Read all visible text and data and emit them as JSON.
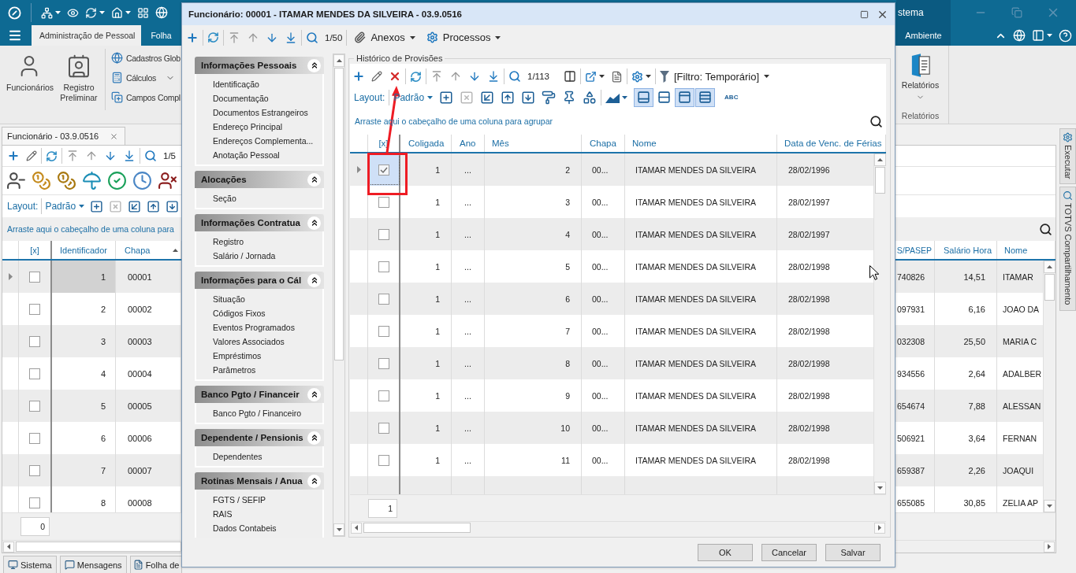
{
  "app": {
    "title": "stema",
    "tabs": [
      {
        "label": "Administração de Pessoal",
        "selected": true
      },
      {
        "label": "Folha",
        "selected": false
      }
    ],
    "context_tab": {
      "label": "Ambiente",
      "selected": false
    },
    "ribbon": {
      "large_buttons": [
        "Funcionários",
        "Registro Preliminar"
      ],
      "small_buttons": [
        {
          "label": "Cadastros Glob",
          "dropdown": false
        },
        {
          "label": "Cálculos",
          "dropdown": true
        },
        {
          "label": "Campos Compl",
          "dropdown": false
        }
      ],
      "reports": {
        "label": "Relatórios",
        "dropdown": true,
        "group": "Relatórios"
      }
    },
    "document_tab": "Funcionário - 03.9.0516",
    "panel": {
      "nav": [
        {
          "disabled": true
        },
        {
          "disabled": true
        },
        {
          "disabled": false
        },
        {
          "disabled": false
        }
      ],
      "counter": "1/5",
      "layout_label": "Layout:",
      "layout": "Padrão",
      "layout_tools": [
        {
          "disabled": false
        },
        {
          "disabled": true
        },
        {
          "disabled": false
        },
        {
          "disabled": false
        },
        {
          "disabled": false
        }
      ],
      "group_hint": "Arraste aqui o cabeçalho de uma coluna para",
      "table": {
        "check_column": "[x]",
        "columns": [
          {
            "label": "Identificador",
            "sorted": false
          },
          {
            "label": "Chapa",
            "sorted": true
          },
          {
            "label": "S/PASEP",
            "sorted": false
          },
          {
            "label": "Salário Hora",
            "sorted": false
          },
          {
            "label": "Nome",
            "sorted": false
          }
        ],
        "rows": [
          {
            "selected": true,
            "checked": false,
            "cells": [
              "1",
              "00001",
              "740826",
              "14,51",
              "ITAMAR"
            ]
          },
          {
            "selected": false,
            "checked": false,
            "cells": [
              "2",
              "00002",
              "097931",
              "6,16",
              "JOAO DA"
            ]
          },
          {
            "selected": false,
            "checked": false,
            "cells": [
              "3",
              "00003",
              "032308",
              "25,50",
              "MARIA C"
            ]
          },
          {
            "selected": false,
            "checked": false,
            "cells": [
              "4",
              "00004",
              "934556",
              "2,64",
              "ADALBER"
            ]
          },
          {
            "selected": false,
            "checked": false,
            "cells": [
              "5",
              "00005",
              "654674",
              "7,88",
              "ALESSAN"
            ]
          },
          {
            "selected": false,
            "checked": false,
            "cells": [
              "6",
              "00006",
              "506921",
              "3,64",
              "FERNAN"
            ]
          },
          {
            "selected": false,
            "checked": false,
            "cells": [
              "7",
              "00007",
              "659387",
              "2,26",
              "JOAQUI"
            ]
          },
          {
            "selected": false,
            "checked": false,
            "cells": [
              "8",
              "00008",
              "655085",
              "30,85",
              "ZELIA AP"
            ]
          }
        ]
      },
      "record_count": "0"
    },
    "status_tabs": [
      "Sistema",
      "Mensagens",
      "Folha de"
    ],
    "side_tabs": [
      "Executar",
      "TOTVS Compartilhamento"
    ]
  },
  "dialog": {
    "title": "Funcionário: 00001 - ITAMAR MENDES DA SILVEIRA - 03.9.0516",
    "toolbar": {
      "nav": [
        {
          "disabled": true
        },
        {
          "disabled": true
        },
        {
          "disabled": false
        },
        {
          "disabled": false
        }
      ],
      "counter": "1/50",
      "menus": [
        "Anexos",
        "Processos"
      ]
    },
    "sections": [
      {
        "title": "Informações Pessoais",
        "expanded": true,
        "items": [
          "Identificação",
          "Documentação",
          "Documentos Estrangeiros",
          "Endereço Principal",
          "Endereços Complementa...",
          "Anotação Pessoal"
        ]
      },
      {
        "title": "Alocações",
        "expanded": true,
        "items": [
          "Seção"
        ]
      },
      {
        "title": "Informações Contratua",
        "expanded": true,
        "items": [
          "Registro",
          "Salário / Jornada"
        ]
      },
      {
        "title": "Informações para o Cál",
        "expanded": true,
        "items": [
          "Situação",
          "Códigos Fixos",
          "Eventos Programados",
          "Valores Associados",
          "Empréstimos",
          "Parâmetros"
        ]
      },
      {
        "title": "Banco Pgto / Financeir",
        "expanded": true,
        "items": [
          "Banco Pgto / Financeiro"
        ]
      },
      {
        "title": "Dependente / Pensionis",
        "expanded": true,
        "items": [
          "Dependentes"
        ]
      },
      {
        "title": "Rotinas Mensais / Anua",
        "expanded": true,
        "items": [
          "FGTS / SEFIP",
          "RAIS",
          "Dados Contabeis"
        ]
      }
    ],
    "history": {
      "title": "Histórico de Provisões",
      "nav": [
        {
          "disabled": true
        },
        {
          "disabled": true
        },
        {
          "disabled": false
        },
        {
          "disabled": false
        }
      ],
      "counter": "1/113",
      "filter": "[Filtro: Temporário]",
      "layout_label": "Layout:",
      "layout": "Padrão",
      "layout_tools": [
        {
          "disabled": false
        },
        {
          "disabled": true
        },
        {
          "disabled": false
        },
        {
          "disabled": false
        },
        {
          "disabled": false
        },
        {
          "disabled": false
        },
        {
          "disabled": false
        },
        {
          "disabled": false
        }
      ],
      "view_toggles": [
        {
          "on": true
        },
        {
          "on": false
        },
        {
          "on": true
        },
        {
          "on": true
        }
      ],
      "text_tool": "ABC",
      "group_hint": "Arraste aqui o cabeçalho de uma coluna para agrupar",
      "grid": {
        "check_column": "[x]",
        "columns": [
          "Coligada",
          "Ano",
          "Mês",
          "Chapa",
          "Nome",
          "Data de Venc. de Férias"
        ],
        "rows": [
          {
            "selected": true,
            "checked": true,
            "cells": [
              "1",
              "...",
              "2",
              "00...",
              "ITAMAR MENDES DA SILVEIRA",
              "28/02/1996"
            ]
          },
          {
            "selected": false,
            "checked": false,
            "cells": [
              "1",
              "...",
              "3",
              "00...",
              "ITAMAR MENDES DA SILVEIRA",
              "28/02/1997"
            ]
          },
          {
            "selected": false,
            "checked": false,
            "cells": [
              "1",
              "...",
              "4",
              "00...",
              "ITAMAR MENDES DA SILVEIRA",
              "28/02/1997"
            ]
          },
          {
            "selected": false,
            "checked": false,
            "cells": [
              "1",
              "...",
              "5",
              "00...",
              "ITAMAR MENDES DA SILVEIRA",
              "28/02/1998"
            ]
          },
          {
            "selected": false,
            "checked": false,
            "cells": [
              "1",
              "...",
              "6",
              "00...",
              "ITAMAR MENDES DA SILVEIRA",
              "28/02/1998"
            ]
          },
          {
            "selected": false,
            "checked": false,
            "cells": [
              "1",
              "...",
              "7",
              "00...",
              "ITAMAR MENDES DA SILVEIRA",
              "28/02/1998"
            ]
          },
          {
            "selected": false,
            "checked": false,
            "cells": [
              "1",
              "...",
              "8",
              "00...",
              "ITAMAR MENDES DA SILVEIRA",
              "28/02/1998"
            ]
          },
          {
            "selected": false,
            "checked": false,
            "cells": [
              "1",
              "...",
              "9",
              "00...",
              "ITAMAR MENDES DA SILVEIRA",
              "28/02/1998"
            ]
          },
          {
            "selected": false,
            "checked": false,
            "cells": [
              "1",
              "...",
              "10",
              "00...",
              "ITAMAR MENDES DA SILVEIRA",
              "28/02/1998"
            ]
          },
          {
            "selected": false,
            "checked": false,
            "cells": [
              "1",
              "...",
              "11",
              "00...",
              "ITAMAR MENDES DA SILVEIRA",
              "28/02/1998"
            ]
          }
        ]
      },
      "record_count": "1"
    },
    "buttons": [
      "OK",
      "Cancelar",
      "Salvar"
    ]
  }
}
